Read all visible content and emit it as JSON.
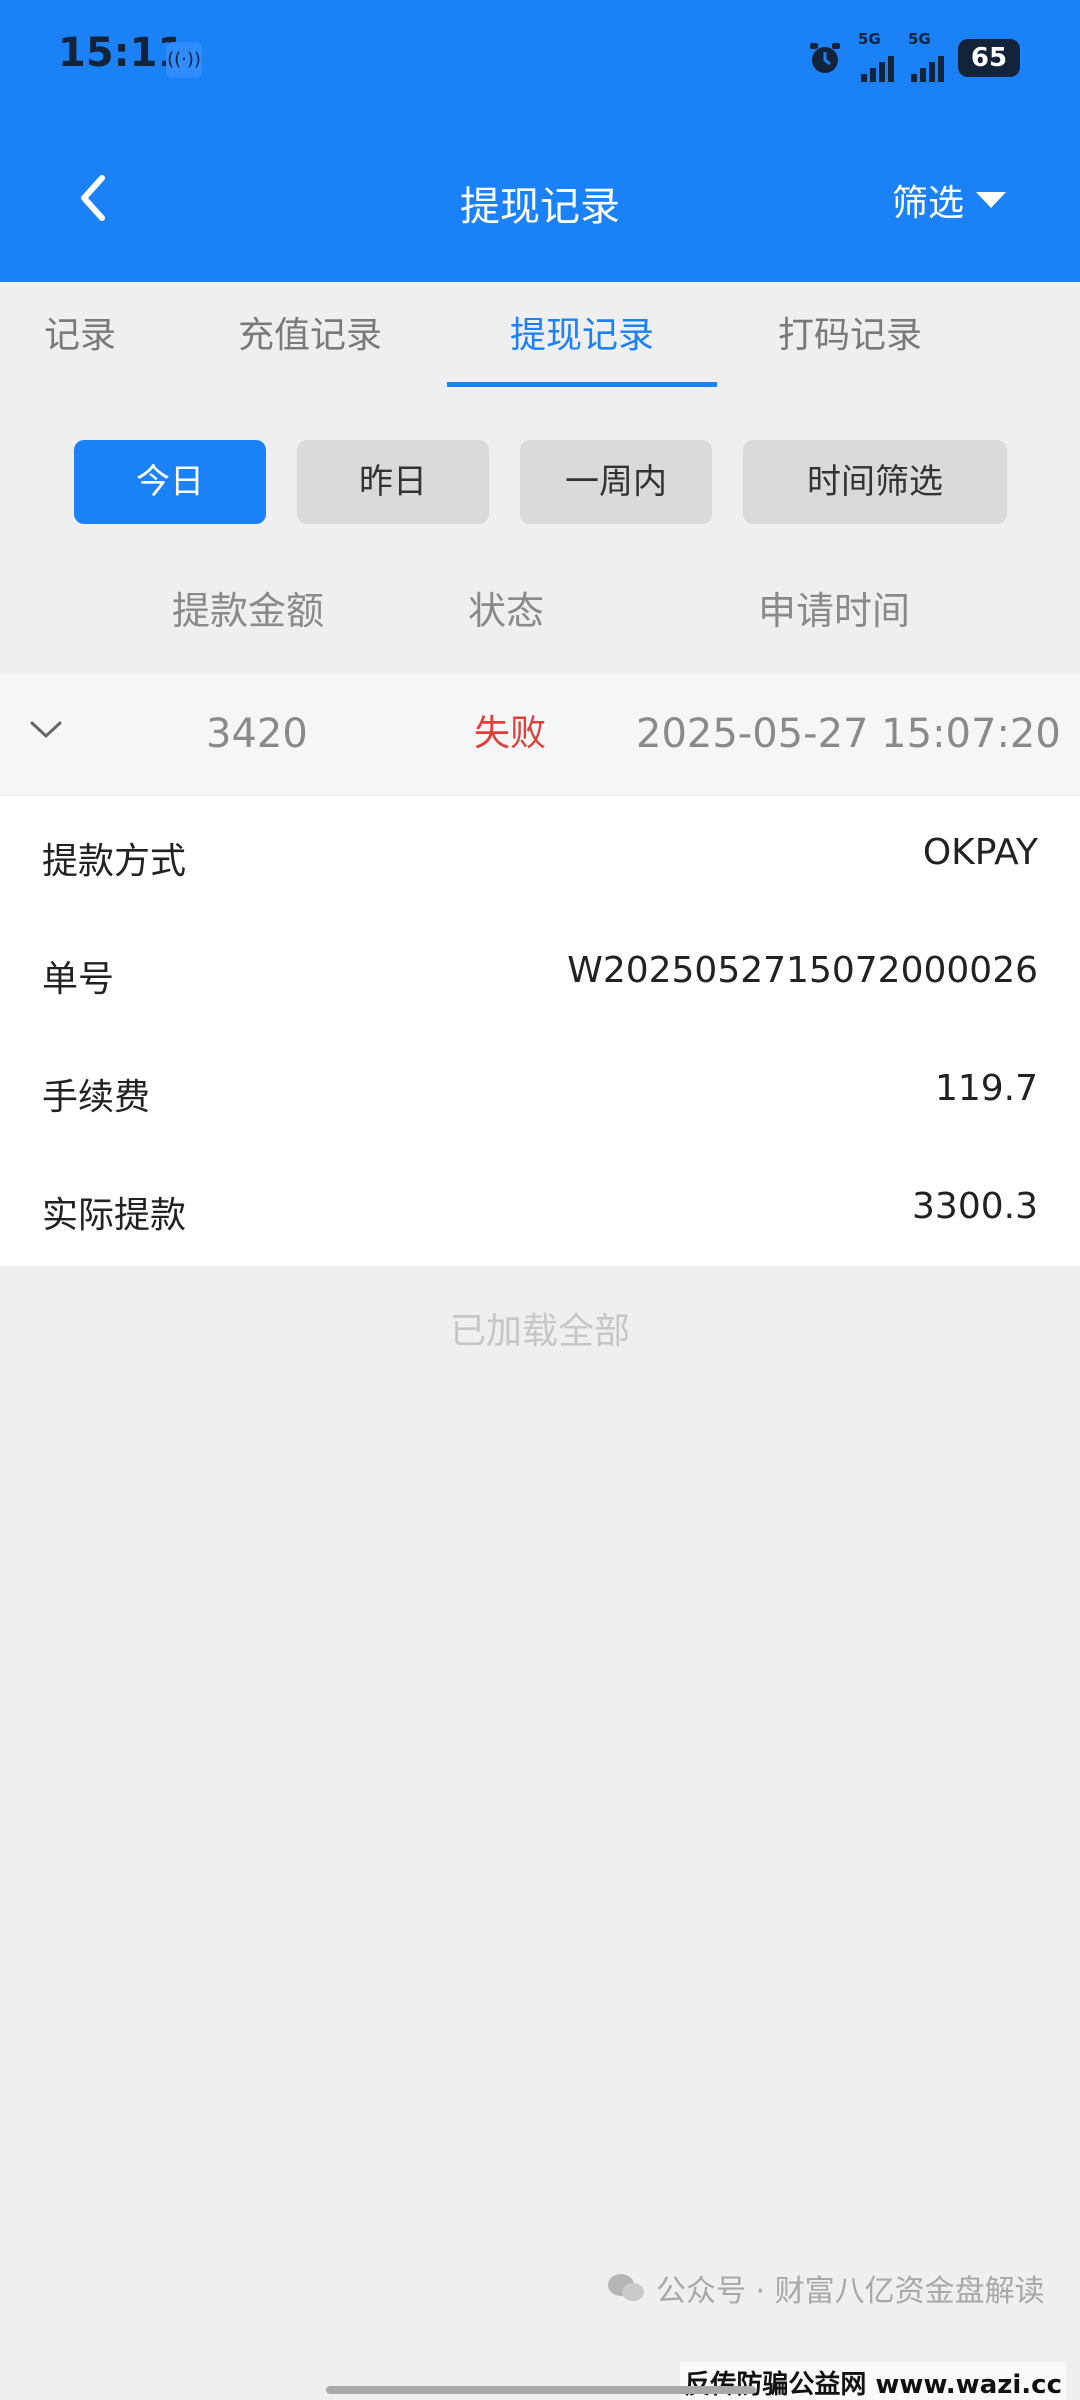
{
  "status_bar": {
    "time": "15:11",
    "net1": "5G",
    "net2": "5G",
    "battery": "65"
  },
  "header": {
    "title": "提现记录",
    "filter_label": "筛选"
  },
  "tabs": [
    {
      "label": "记录"
    },
    {
      "label": "充值记录"
    },
    {
      "label": "提现记录"
    },
    {
      "label": "打码记录"
    }
  ],
  "date_filters": [
    {
      "label": "今日"
    },
    {
      "label": "昨日"
    },
    {
      "label": "一周内"
    },
    {
      "label": "时间筛选"
    }
  ],
  "table_header": {
    "amount": "提款金额",
    "status": "状态",
    "time": "申请时间"
  },
  "record": {
    "amount": "3420",
    "status": "失败",
    "time": "2025-05-27 15:07:20",
    "details": [
      {
        "label": "提款方式",
        "value": "OKPAY"
      },
      {
        "label": "单号",
        "value": "W2025052715072000026"
      },
      {
        "label": "手续费",
        "value": "119.7"
      },
      {
        "label": "实际提款",
        "value": "3300.3"
      }
    ]
  },
  "footer_text": "已加载全部",
  "watermark": {
    "text": "公众号 · 财富八亿资金盘解读",
    "site": "反传防骗公益网 www.wazi.cc"
  },
  "colors": {
    "accent": "#1a82f6",
    "failure": "#e0403a"
  }
}
